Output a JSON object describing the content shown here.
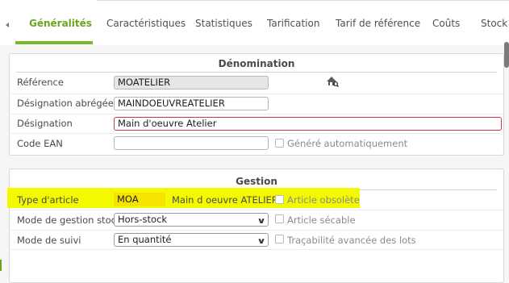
{
  "tabs": [
    {
      "label": "Généralités",
      "active": true
    },
    {
      "label": "Caractéristiques"
    },
    {
      "label": "Statistiques"
    },
    {
      "label": "Tarification"
    },
    {
      "label": "Tarif de référence"
    },
    {
      "label": "Coûts"
    },
    {
      "label": "Stock"
    }
  ],
  "denomination": {
    "title": "Dénomination",
    "reference": {
      "label": "Référence",
      "value": "MOATELIER"
    },
    "designation_abregee": {
      "label": "Désignation abrégée",
      "value": "MAINDOEUVREATELIER"
    },
    "designation": {
      "label": "Désignation",
      "value": "Main d'oeuvre Atelier"
    },
    "code_ean": {
      "label": "Code EAN",
      "value": "",
      "checkbox_label": "Généré automatiquement"
    }
  },
  "gestion": {
    "title": "Gestion",
    "type_article": {
      "label": "Type d'article",
      "value": "MOA",
      "description": "Main d oeuvre ATELIER",
      "checkbox_label": "Article obsolète"
    },
    "mode_gestion_stock": {
      "label": "Mode de gestion stock",
      "value": "Hors-stock",
      "checkbox_label": "Article sécable"
    },
    "mode_suivi": {
      "label": "Mode de suivi",
      "value": "En quantité",
      "checkbox_label": "Traçabilité avancée des lots"
    }
  },
  "colors": {
    "accent": "#7ab82a",
    "highlight": "#f4f900",
    "required_border": "#d2364a"
  }
}
